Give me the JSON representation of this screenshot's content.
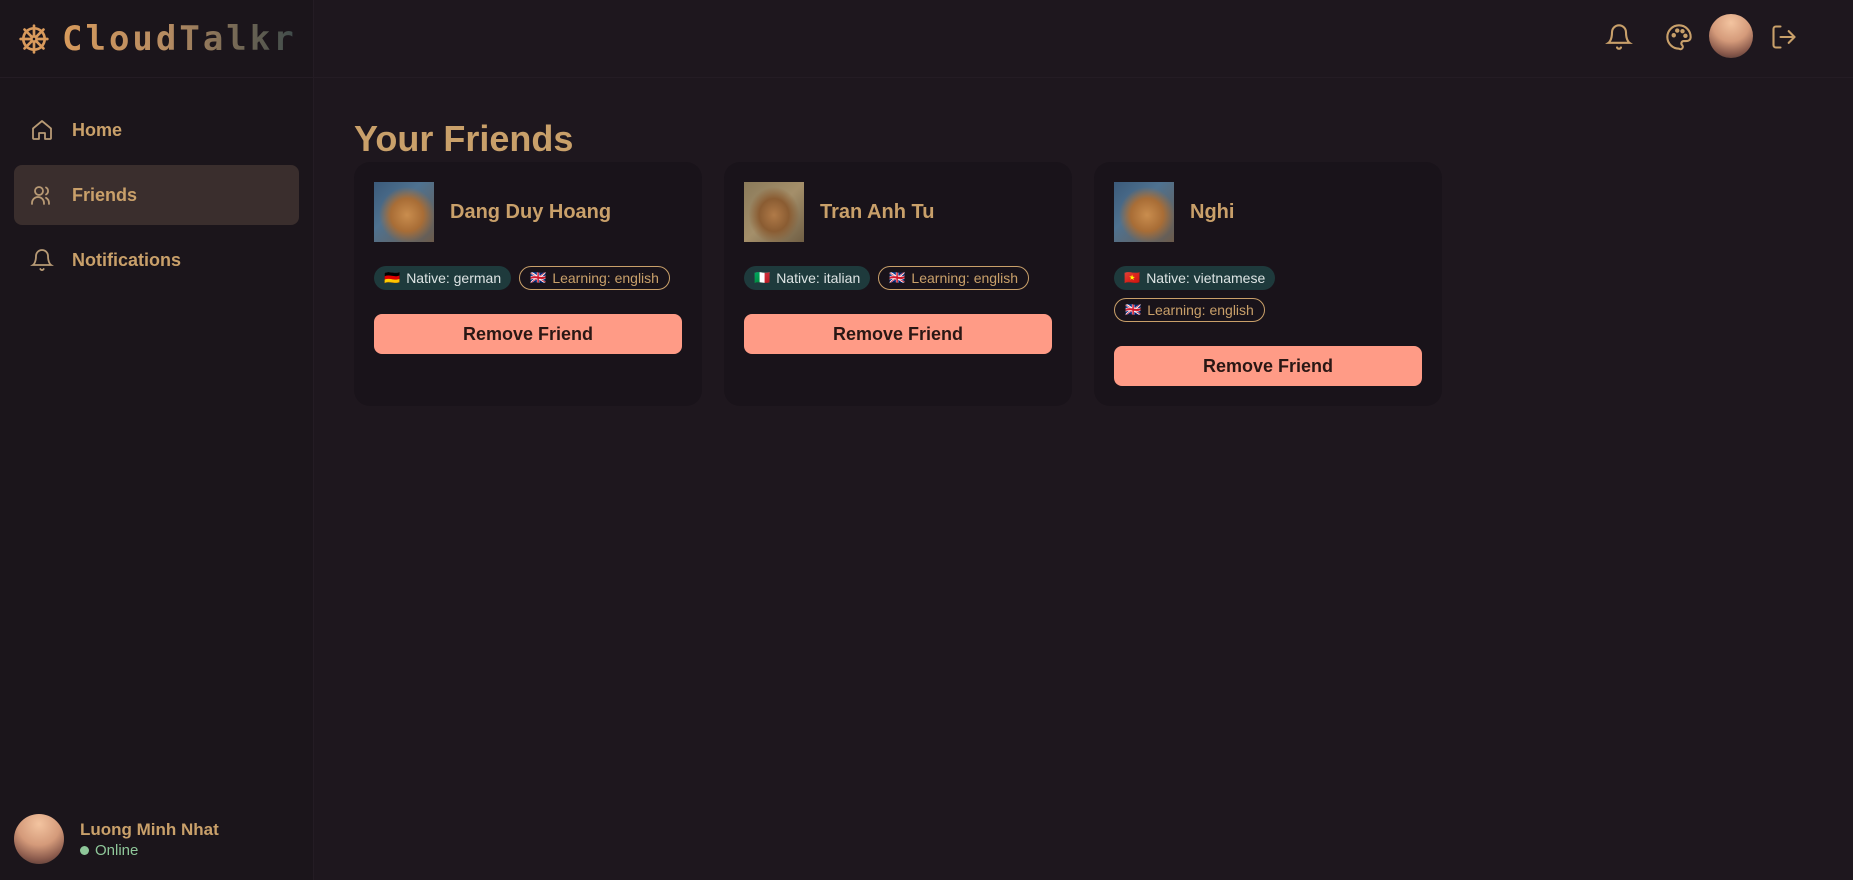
{
  "app": {
    "name": "CloudTalkr",
    "logo_icon": "ship-wheel-icon",
    "accent": "#c9a06a",
    "background": "#1e171e"
  },
  "sidebar": {
    "items": [
      {
        "label": "Home",
        "icon": "home-icon",
        "active": false
      },
      {
        "label": "Friends",
        "icon": "users-icon",
        "active": true
      },
      {
        "label": "Notifications",
        "icon": "bell-icon",
        "active": false
      }
    ],
    "user": {
      "name": "Luong Minh Nhat",
      "status": "Online",
      "status_color": "#8fc79a"
    }
  },
  "header": {
    "icons": [
      "bell-icon",
      "palette-icon",
      "avatar",
      "logout-icon"
    ]
  },
  "main": {
    "title": "Your Friends",
    "remove_label": "Remove Friend",
    "friends": [
      {
        "name": "Dang Duy Hoang",
        "native": "Native: german",
        "native_flag": "🇩🇪",
        "learning": "Learning: english",
        "learning_flag": "🇬🇧"
      },
      {
        "name": "Tran Anh Tu",
        "native": "Native: italian",
        "native_flag": "🇮🇹",
        "learning": "Learning: english",
        "learning_flag": "🇬🇧"
      },
      {
        "name": "Nghi",
        "native": "Native: vietnamese",
        "native_flag": "🇻🇳",
        "learning": "Learning: english",
        "learning_flag": "🇬🇧"
      }
    ],
    "button_color": "#ff9b86"
  }
}
